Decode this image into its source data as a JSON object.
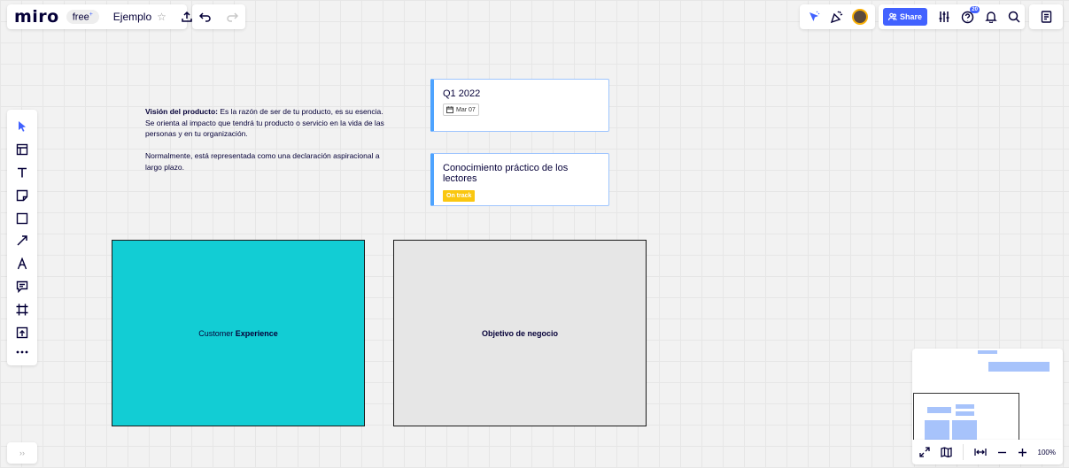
{
  "header": {
    "logo": "miro",
    "plan_badge": "free",
    "plan_badge_sup": "+",
    "board_name": "Ejemplo",
    "share_label": "Share",
    "help_badge": "20"
  },
  "canvas": {
    "vision_title": "Visión del producto:",
    "vision_body": " Es la razón de ser de tu producto, es su esencia. Se orienta al impacto que tendrá tu producto o servicio en la vida de las personas y en tu organización.",
    "vision_body2": "Normalmente, está representada como una declaración aspiracional a largo plazo.",
    "cards": [
      {
        "title": "Q1 2022",
        "date": "Mar 07"
      },
      {
        "title": "Conocimiento práctico de los lectores",
        "status": "On track"
      }
    ],
    "shapes": [
      {
        "label_normal": "Customer ",
        "label_bold": "Experience",
        "color": "#12cdd4"
      },
      {
        "label": "Objetivo de negocio",
        "color": "#e6e6e6"
      }
    ]
  },
  "zoom": {
    "level": "100%"
  },
  "colors": {
    "accent": "#4262ff",
    "cyan": "#12cdd4",
    "status_yellow": "#fac710"
  }
}
